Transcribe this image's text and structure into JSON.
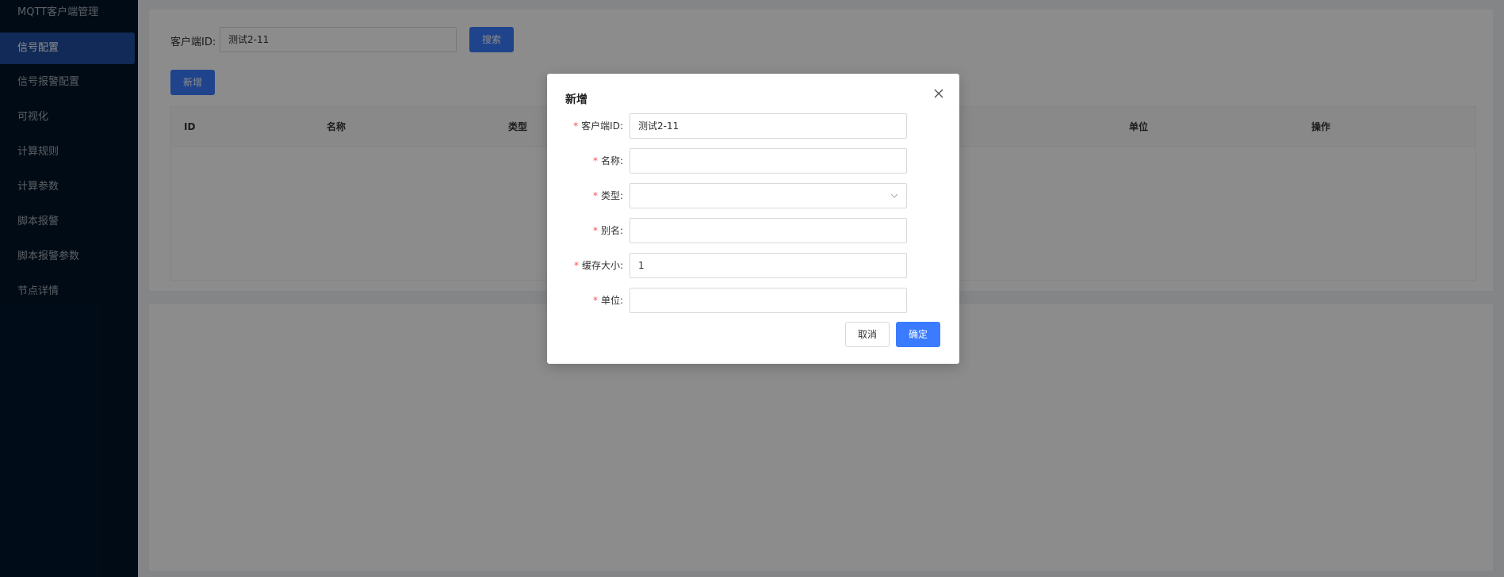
{
  "sidebar": {
    "brand": "MQTT客户端管理",
    "items": [
      {
        "label": "信号配置",
        "active": true
      },
      {
        "label": "信号报警配置"
      },
      {
        "label": "可视化"
      },
      {
        "label": "计算规则"
      },
      {
        "label": "计算参数"
      },
      {
        "label": "脚本报警"
      },
      {
        "label": "脚本报警参数"
      },
      {
        "label": "节点详情"
      }
    ]
  },
  "search": {
    "label": "客户端ID:",
    "value": "测试2-11",
    "button": "搜索"
  },
  "toolbar": {
    "add_label": "新增"
  },
  "table": {
    "columns": [
      "ID",
      "名称",
      "类型",
      "单位",
      "操作"
    ]
  },
  "modal": {
    "title": "新增",
    "fields": [
      {
        "label": "客户端ID:",
        "value": "测试2-11",
        "required": true
      },
      {
        "label": "名称:",
        "value": "",
        "required": true
      },
      {
        "label": "类型:",
        "value": "",
        "required": true,
        "type": "select"
      },
      {
        "label": "别名:",
        "value": "",
        "required": true
      },
      {
        "label": "缓存大小:",
        "value": "1",
        "required": true
      },
      {
        "label": "单位:",
        "value": "",
        "required": true
      }
    ],
    "cancel_label": "取消",
    "ok_label": "确定"
  },
  "colors": {
    "sidebar_bg": "#001529",
    "active_item": "#1f4d9e",
    "primary": "#3b7cff",
    "required": "#ff4d4f"
  }
}
